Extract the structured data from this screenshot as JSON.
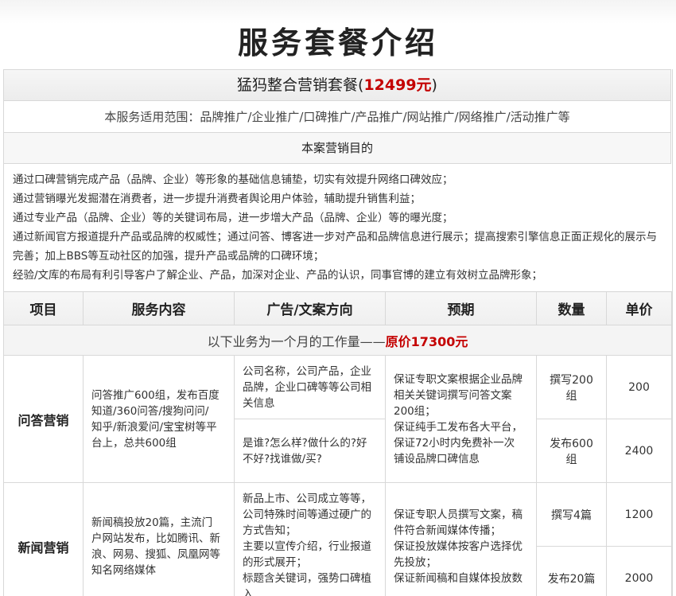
{
  "page_title": "服务套餐介绍",
  "package": {
    "name_prefix": "猛犸整合营销套餐(",
    "price": "12499元",
    "name_suffix": ")"
  },
  "scope": "本服务适用范围：品牌推广/企业推广/口碑推广/产品推广/网站推广/网络推广/活动推广等",
  "purpose_heading": "本案营销目的",
  "goals": [
    "通过口碑营销完成产品（品牌、企业）等形象的基础信息铺垫，切实有效提升网络口碑效应；",
    "通过营销曝光发掘潜在消费者，进一步提升消费者舆论用户体验，辅助提升销售利益；",
    "通过专业产品（品牌、企业）等的关键词布局，进一步增大产品（品牌、企业）等的曝光度；",
    "通过新闻官方报道提升产品或品牌的权威性；通过问答、博客进一步对产品和品牌信息进行展示；提高搜索引擎信息正面正规化的展示与完善；加上BBS等互动社区的加强，提升产品或品牌的口碑环境；",
    "经验/文库的布局有利引导客户了解企业、产品，加深对企业、产品的认识，同事官博的建立有效树立品牌形象；"
  ],
  "table": {
    "headers": [
      "项目",
      "服务内容",
      "广告/文案方向",
      "预期",
      "数量",
      "单价"
    ],
    "month_note_prefix": "以下业务为一个月的工作量——",
    "month_note_price": "原价17300元",
    "qa": {
      "category": "问答营销",
      "content": [
        "问答推广600组，发布百度",
        "知道/360问答/搜狗问问/",
        "知乎/新浪爱问/宝宝树等平",
        "台上，总共600组"
      ],
      "direction_1": [
        "公司名称，公司产品，企业",
        "品牌，企业口碑等等公司相",
        "关信息"
      ],
      "direction_2": [
        "是谁?怎么样?做什么的?好",
        "不好?找谁做/买?"
      ],
      "expectation": [
        "保证专职文案根据企业品牌",
        "相关关键词撰写问答文案",
        "200组；",
        "保证纯手工发布各大平台，",
        "保证72小时内免费补一次",
        "铺设品牌口碑信息"
      ],
      "qty_1": "撰写200组",
      "price_1": "200",
      "qty_2": "发布600组",
      "price_2": "2400"
    },
    "news": {
      "category": "新闻营销",
      "content": [
        "新闻稿投放20篇，主流门",
        "户网站发布，比如腾讯、新",
        "浪、网易、搜狐、凤凰网等",
        "知名网络媒体"
      ],
      "direction": [
        "新品上市、公司成立等等，",
        "公司特殊时间等通过硬广的",
        "方式告知；",
        "主要以宣传介绍，行业报道",
        "的形式展开；",
        "标题含关键词，强势口碑植",
        "入"
      ],
      "expectation": [
        "保证专职人员撰写文案，稿",
        "件符合新闻媒体传播；",
        "保证投放媒体按客户选择优",
        "先投放；",
        "保证新闻稿和自媒体投放数"
      ],
      "qty_1": "撰写4篇",
      "price_1": "1200",
      "qty_2": "发布20篇",
      "price_2": "2000"
    }
  },
  "colors": {
    "accent_red": "#c40000",
    "border": "#d8d8d8",
    "header_bg": "#f2f2f2"
  }
}
